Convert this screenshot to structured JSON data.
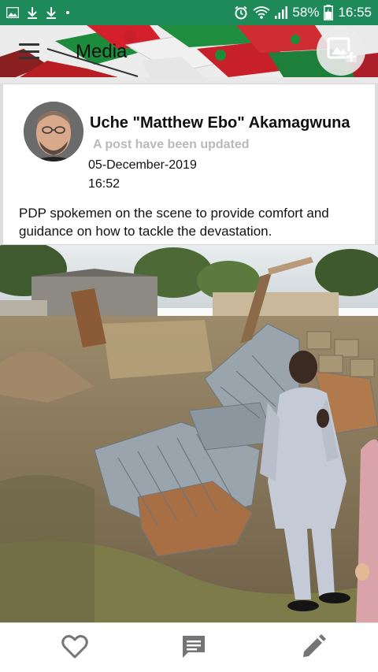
{
  "status_bar": {
    "battery_percent": "58%",
    "time": "16:55",
    "icons": [
      "image-icon",
      "download-icon",
      "download-icon",
      "dot-icon",
      "alarm-icon",
      "wifi-icon",
      "signal-icon",
      "battery-icon"
    ]
  },
  "app_bar": {
    "title": "Media",
    "menu_icon": "hamburger-menu-icon",
    "add_photo_icon": "add-photo-icon"
  },
  "post": {
    "author": "Uche \"Matthew Ebo\" Akamagwuna",
    "subtitle": "A post have been updated",
    "date": "05-December-2019",
    "time": "16:52",
    "text": "PDP spokemen on the scene to provide comfort and guidance on how to tackle the devastation."
  },
  "actions": {
    "like_icon": "heart-outline-icon",
    "comment_icon": "comment-icon",
    "edit_icon": "pencil-icon"
  },
  "colors": {
    "status_bar": "#1e8a5a",
    "subtitle": "#b9b9b9",
    "icon_gray": "#757575"
  }
}
